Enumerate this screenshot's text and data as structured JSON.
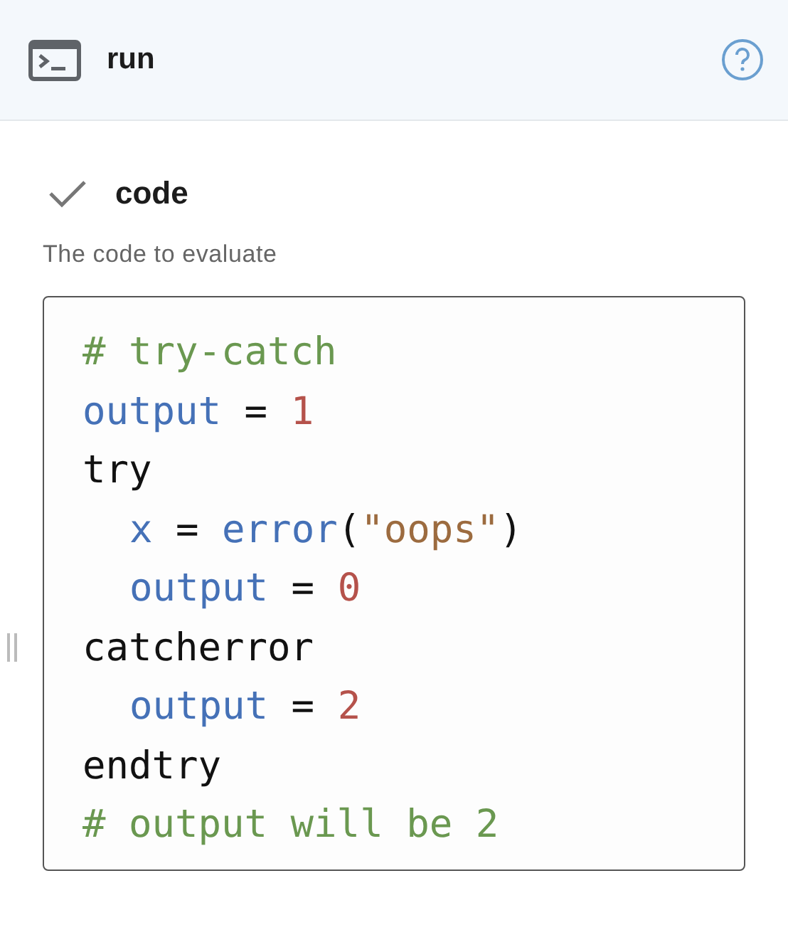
{
  "header": {
    "title": "run"
  },
  "field": {
    "label": "code",
    "checked": true,
    "description": "The code to evaluate"
  },
  "code_lines": [
    {
      "tokens": [
        {
          "kind": "comment",
          "text": "# try-catch"
        }
      ]
    },
    {
      "tokens": [
        {
          "kind": "variable",
          "text": "output"
        },
        {
          "kind": "plain",
          "text": " = "
        },
        {
          "kind": "number",
          "text": "1"
        }
      ]
    },
    {
      "tokens": [
        {
          "kind": "plain",
          "text": "try"
        }
      ],
      "children": [
        {
          "tokens": [
            {
              "kind": "variable",
              "text": "x"
            },
            {
              "kind": "plain",
              "text": " = "
            },
            {
              "kind": "variable",
              "text": "error"
            },
            {
              "kind": "plain",
              "text": "("
            },
            {
              "kind": "string",
              "text": "\"oops\""
            },
            {
              "kind": "plain",
              "text": ")"
            }
          ]
        },
        {
          "tokens": [
            {
              "kind": "variable",
              "text": "output"
            },
            {
              "kind": "plain",
              "text": " = "
            },
            {
              "kind": "number",
              "text": "0"
            }
          ]
        }
      ]
    },
    {
      "tokens": [
        {
          "kind": "plain",
          "text": "catcherror"
        }
      ],
      "children": [
        {
          "tokens": [
            {
              "kind": "variable",
              "text": "output"
            },
            {
              "kind": "plain",
              "text": " = "
            },
            {
              "kind": "number",
              "text": "2"
            }
          ]
        }
      ]
    },
    {
      "tokens": [
        {
          "kind": "plain",
          "text": "endtry"
        }
      ]
    },
    {
      "tokens": [
        {
          "kind": "comment",
          "text": "# output will be 2"
        }
      ]
    }
  ]
}
